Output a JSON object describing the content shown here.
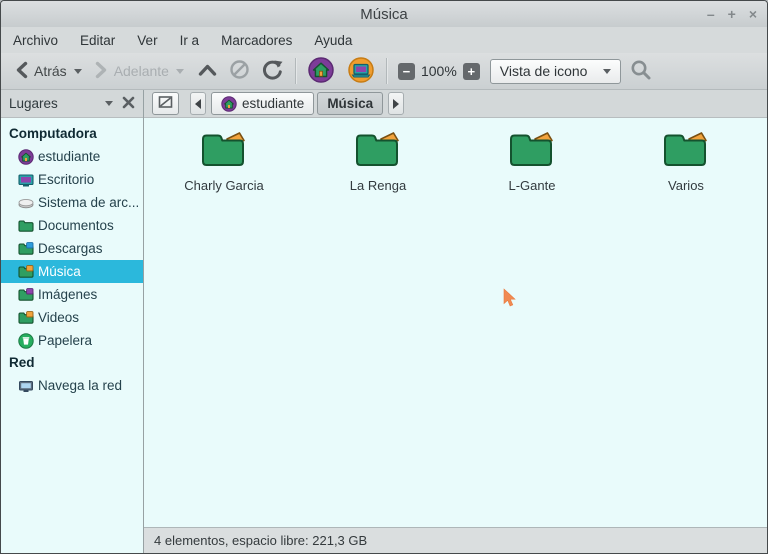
{
  "window": {
    "title": "Música",
    "controls": {
      "minimize": "–",
      "maximize": "+",
      "close": "×"
    }
  },
  "menubar": {
    "items": [
      "Archivo",
      "Editar",
      "Ver",
      "Ir a",
      "Marcadores",
      "Ayuda"
    ]
  },
  "toolbar": {
    "back_label": "Atrás",
    "forward_label": "Adelante",
    "zoom_out_glyph": "−",
    "zoom_level": "100%",
    "zoom_in_glyph": "+",
    "view_selector": "Vista de icono",
    "icons": [
      "back-icon",
      "back-dropdown-icon",
      "forward-icon",
      "forward-dropdown-icon",
      "up-icon",
      "cancel-icon",
      "reload-icon",
      "home-icon",
      "desktop-icon",
      "zoom-out-icon",
      "zoom-in-icon",
      "view-dropdown-icon",
      "search-icon"
    ]
  },
  "places": {
    "title": "Lugares"
  },
  "pathbar": {
    "buttons": [
      {
        "label": "estudiante",
        "icon": "home-circle",
        "active": false
      },
      {
        "label": "Música",
        "icon": null,
        "active": true
      }
    ]
  },
  "sidebar": {
    "sections": [
      {
        "header": "Computadora",
        "items": [
          {
            "label": "estudiante",
            "icon": "home-circle",
            "selected": false
          },
          {
            "label": "Escritorio",
            "icon": "desktop",
            "selected": false
          },
          {
            "label": "Sistema de arc...",
            "icon": "drive",
            "selected": false
          },
          {
            "label": "Documentos",
            "icon": "folder-plain",
            "selected": false
          },
          {
            "label": "Descargas",
            "icon": "folder-downloads",
            "selected": false
          },
          {
            "label": "Música",
            "icon": "folder-music",
            "selected": true
          },
          {
            "label": "Imágenes",
            "icon": "folder-images",
            "selected": false
          },
          {
            "label": "Videos",
            "icon": "folder-video",
            "selected": false
          },
          {
            "label": "Papelera",
            "icon": "trash",
            "selected": false
          }
        ]
      },
      {
        "header": "Red",
        "items": [
          {
            "label": "Navega la red",
            "icon": "network",
            "selected": false
          }
        ]
      }
    ]
  },
  "files": {
    "items": [
      {
        "name": "Charly Garcia",
        "icon": "folder"
      },
      {
        "name": "La Renga",
        "icon": "folder"
      },
      {
        "name": "L-Gante",
        "icon": "folder"
      },
      {
        "name": "Varios",
        "icon": "folder"
      }
    ]
  },
  "statusbar": {
    "text": "4 elementos, espacio libre: 221,3 GB"
  },
  "colors": {
    "selection": "#2bb8dc",
    "folder_green": "#2f9e62",
    "folder_outline": "#14522e",
    "folder_tab_orange": "#f2a33c",
    "home_purple": "#7d3c98",
    "desktop_orange": "#f09d2f",
    "content_bg": "#e9fbfb",
    "cursor_orange": "#f08a52"
  }
}
